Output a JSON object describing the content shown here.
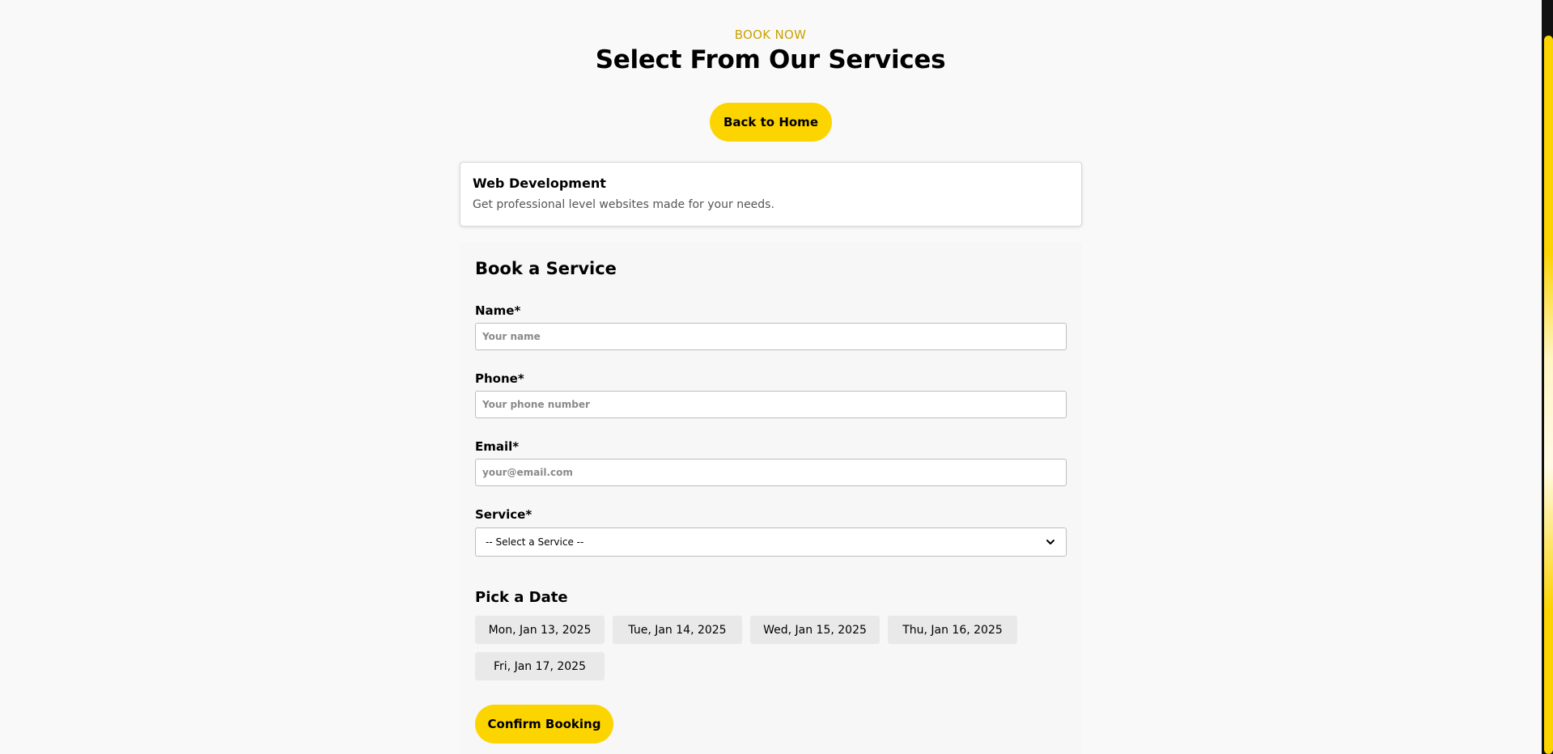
{
  "header": {
    "eyebrow": "BOOK NOW",
    "title": "Select From Our Services",
    "back_label": "Back to Home"
  },
  "service_card": {
    "title": "Web Development",
    "description": "Get professional level websites made for your needs."
  },
  "form": {
    "title": "Book a Service",
    "name": {
      "label": "Name*",
      "placeholder": "Your name",
      "value": ""
    },
    "phone": {
      "label": "Phone*",
      "placeholder": "Your phone number",
      "value": ""
    },
    "email": {
      "label": "Email*",
      "placeholder": "your@email.com",
      "value": ""
    },
    "service": {
      "label": "Service*",
      "selected": "-- Select a Service --"
    },
    "date_heading": "Pick a Date",
    "dates": [
      "Mon, Jan 13, 2025",
      "Tue, Jan 14, 2025",
      "Wed, Jan 15, 2025",
      "Thu, Jan 16, 2025",
      "Fri, Jan 17, 2025"
    ],
    "confirm_label": "Confirm Booking"
  },
  "colors": {
    "accent": "#fcd400",
    "eyebrow": "#c9a300",
    "background": "#f9f9f9",
    "chip": "#e9e9e9"
  },
  "icons": {
    "select_arrow": "chevron-down-icon"
  }
}
